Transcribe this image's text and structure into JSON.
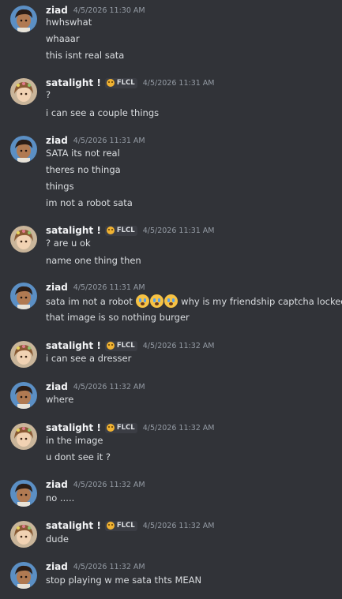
{
  "users": {
    "ziad": {
      "name": "ziad",
      "avatar_icon": "avatar-dark-hair",
      "color": "#f2f3f5"
    },
    "satalight": {
      "name": "satalight !",
      "avatar_icon": "avatar-brown-hair-flowers",
      "tag": "FLCL",
      "tag_icon": "smiley-badge-icon"
    }
  },
  "messages": [
    {
      "user": "ziad",
      "time": "4/5/2026 11:30 AM",
      "lines": [
        "hwhswhat",
        "whaaar",
        "this isnt real sata"
      ]
    },
    {
      "user": "satalight !",
      "tag": "FLCL",
      "time": "4/5/2026 11:31 AM",
      "lines": [
        "?",
        "i can see a couple things"
      ]
    },
    {
      "user": "ziad",
      "time": "4/5/2026 11:31 AM",
      "lines": [
        "SATA its not real",
        "theres no thinga",
        "things",
        "im not a robot sata"
      ]
    },
    {
      "user": "satalight !",
      "tag": "FLCL",
      "time": "4/5/2026 11:31 AM",
      "lines": [
        "? are u ok",
        "name one thing then"
      ]
    },
    {
      "user": "ziad",
      "time": "4/5/2026 11:31 AM",
      "lines": [
        "sata im not a robot",
        "that image is so nothing burger"
      ],
      "line1_suffix": "why is my friendship captcha locked"
    },
    {
      "user": "satalight !",
      "tag": "FLCL",
      "time": "4/5/2026 11:32 AM",
      "lines": [
        "i can see a dresser"
      ]
    },
    {
      "user": "ziad",
      "time": "4/5/2026 11:32 AM",
      "lines": [
        "where"
      ]
    },
    {
      "user": "satalight !",
      "tag": "FLCL",
      "time": "4/5/2026 11:32 AM",
      "lines": [
        "in the image",
        "u dont see it ?"
      ]
    },
    {
      "user": "ziad",
      "time": "4/5/2026 11:32 AM",
      "lines": [
        "no ....."
      ]
    },
    {
      "user": "satalight !",
      "tag": "FLCL",
      "time": "4/5/2026 11:32 AM",
      "lines": [
        "dude"
      ]
    },
    {
      "user": "ziad",
      "time": "4/5/2026 11:32 AM",
      "lines": [
        "stop playing w me sata thts MEAN"
      ]
    }
  ]
}
